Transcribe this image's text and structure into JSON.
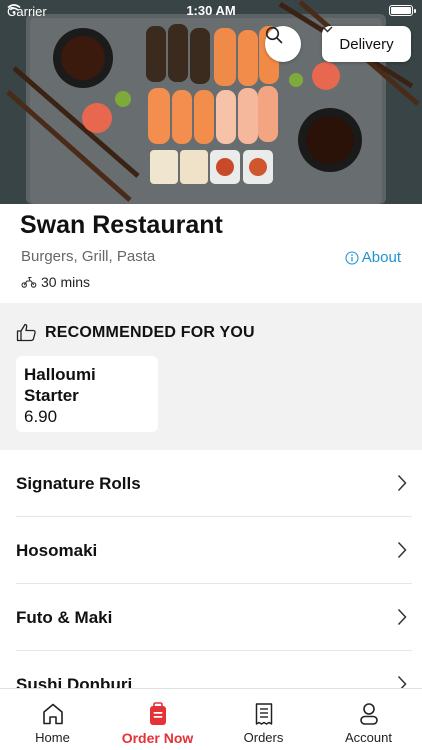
{
  "status_bar": {
    "carrier": "Carrier",
    "time": "1:30 AM"
  },
  "header": {
    "delivery_label": "Delivery"
  },
  "restaurant": {
    "name": "Swan Restaurant",
    "cuisine": "Burgers, Grill, Pasta",
    "about_label": "About",
    "delivery_time": "30 mins"
  },
  "recommended": {
    "title": "RECOMMENDED FOR YOU",
    "items": [
      {
        "name": "Halloumi Starter",
        "price": "6.90"
      }
    ]
  },
  "categories": [
    "Signature Rolls",
    "Hosomaki",
    "Futo & Maki",
    "Sushi Donburi"
  ],
  "tabbar": {
    "tabs": [
      {
        "label": "Home",
        "icon": "home-icon"
      },
      {
        "label": "Order Now",
        "icon": "order-bag-icon"
      },
      {
        "label": "Orders",
        "icon": "receipt-icon"
      },
      {
        "label": "Account",
        "icon": "user-icon"
      }
    ],
    "active": "Order Now"
  },
  "colors": {
    "accent": "#e53238",
    "link": "#1e94d2",
    "section_bg": "#f2f2f2"
  }
}
